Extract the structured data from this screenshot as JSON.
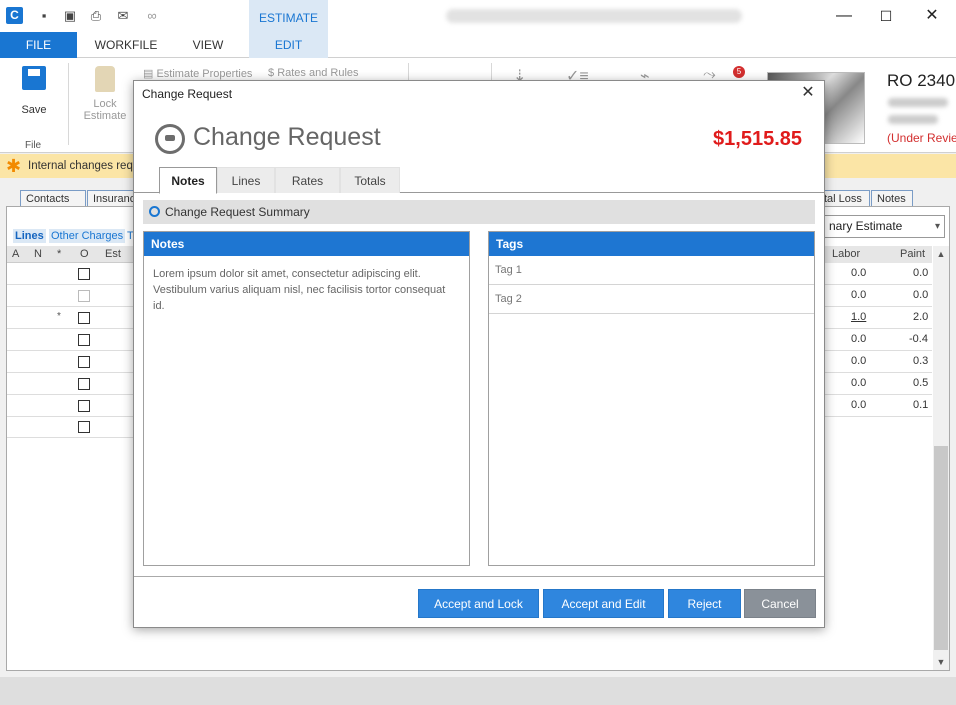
{
  "window": {
    "context_tab": "ESTIMATE",
    "controls": {
      "minimize": "—",
      "maximize": "☐",
      "close": "✕"
    }
  },
  "menu": {
    "file": "FILE",
    "workfile": "WORKFILE",
    "view": "VIEW",
    "edit": "EDIT"
  },
  "ribbon": {
    "save_label": "Save",
    "file_group_label": "File",
    "lock_label": "Lock Estimate",
    "estimate_properties": "Estimate Properties",
    "rates_and_rules": "Rates and Rules",
    "notification_badge": "5",
    "repair_order_title": "RO 2340",
    "review_status": "(Under Review"
  },
  "notice": {
    "text": "Internal changes requ"
  },
  "background": {
    "tabs_left": [
      "Contacts",
      "Insuranc"
    ],
    "tabs_right": [
      "tal Loss",
      "Notes"
    ],
    "sub_tabs": [
      "Lines",
      "Other Charges",
      "T"
    ],
    "grid_headers": [
      "A",
      "N",
      "*",
      "O",
      "Est"
    ],
    "dropdown_value": "nary Estimate",
    "right_grid_headers": [
      "Labor",
      "Paint"
    ],
    "right_rows": [
      {
        "labor": "0.0",
        "paint": "0.0"
      },
      {
        "labor": "0.0",
        "paint": "0.0"
      },
      {
        "labor": "1.0",
        "paint": "2.0"
      },
      {
        "labor": "0.0",
        "paint": "-0.4"
      },
      {
        "labor": "0.0",
        "paint": "0.3"
      },
      {
        "labor": "0.0",
        "paint": "0.5"
      },
      {
        "labor": "0.0",
        "paint": "0.1"
      }
    ],
    "row_marker": "*"
  },
  "modal": {
    "window_title": "Change Request",
    "heading": "Change Request",
    "amount": "$1,515.85",
    "tabs": [
      "Notes",
      "Lines",
      "Rates",
      "Totals"
    ],
    "summary_label": "Change Request Summary",
    "notes": {
      "header": "Notes",
      "body": "Lorem ipsum dolor sit amet, consectetur adipiscing elit. Vestibulum varius aliquam nisl, nec facilisis tortor consequat id."
    },
    "tags": {
      "header": "Tags",
      "items": [
        "Tag 1",
        "Tag 2"
      ]
    },
    "buttons": {
      "accept_lock": "Accept and Lock",
      "accept_edit": "Accept and Edit",
      "reject": "Reject",
      "cancel": "Cancel"
    }
  },
  "colors": {
    "accent": "#1976d2",
    "amount": "#e01b1b",
    "notice_bg": "#fbe5a6"
  }
}
